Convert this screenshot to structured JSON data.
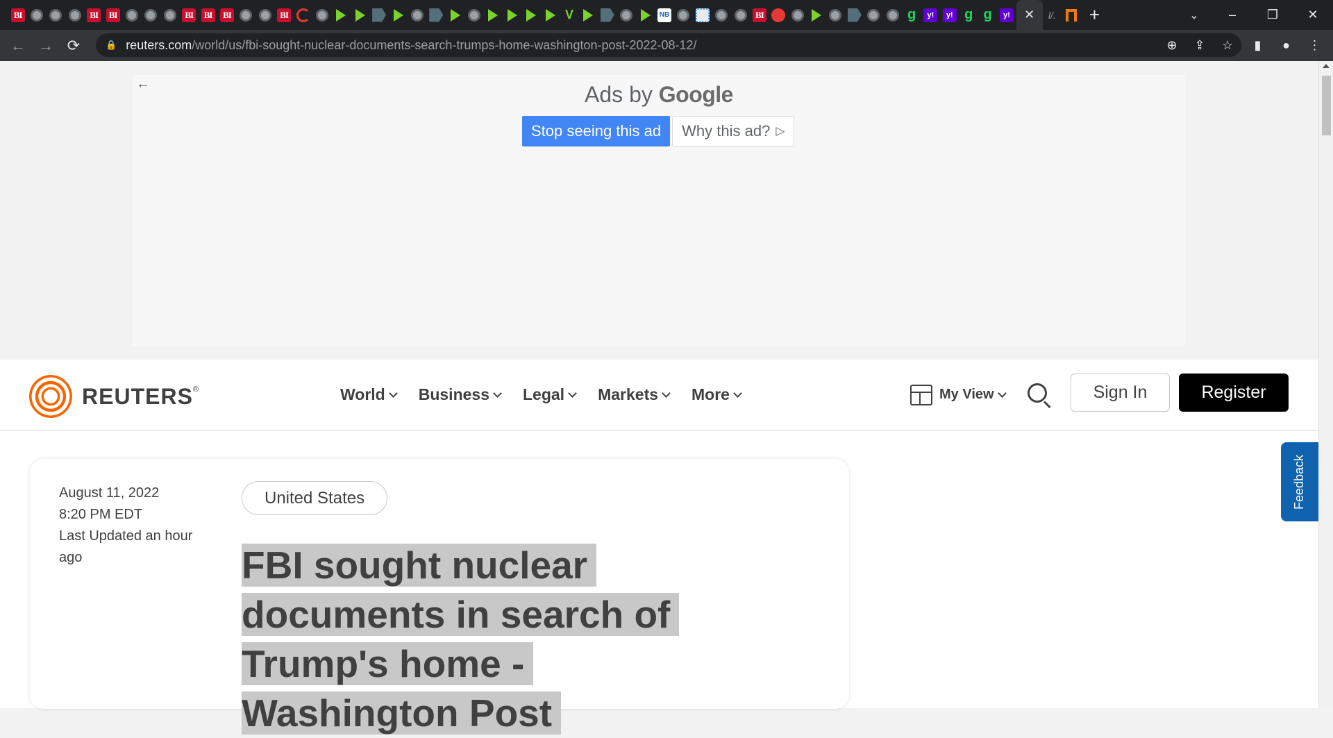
{
  "browser": {
    "tabs": [
      "bi",
      "globe",
      "globe",
      "globe",
      "bi",
      "bi",
      "globe",
      "globe",
      "globe",
      "bi",
      "bi",
      "bi",
      "globe",
      "globe",
      "bi",
      "redc",
      "globe",
      "play",
      "play",
      "flag",
      "play",
      "globe",
      "flag",
      "play",
      "globe",
      "play",
      "play",
      "play",
      "play",
      "vee",
      "play",
      "flag",
      "globe",
      "play",
      "news",
      "globe",
      "chk",
      "globe",
      "globe",
      "bi",
      "red",
      "globe",
      "play",
      "globe",
      "flag",
      "globe",
      "globe",
      "g",
      "yf",
      "yf",
      "g",
      "g",
      "yf"
    ],
    "tab_glyphs": {
      "bi": "BI",
      "yf": "y!",
      "g": "g",
      "vee": "V",
      "news": "NB",
      "slash": "l/."
    },
    "active_tab_close": "✕",
    "new_tab": "+",
    "tab_search": "⌄",
    "window_controls": {
      "minimize": "–",
      "restore": "❐",
      "close": "✕"
    },
    "nav": {
      "back": "←",
      "forward": "→",
      "reload": "⟳"
    },
    "url_host": "reuters.com",
    "url_path": "/world/us/fbi-sought-nuclear-documents-search-trumps-home-washington-post-2022-08-12/",
    "omnibox_icons": {
      "zoom": "⊕",
      "share": "⇪",
      "star": "☆"
    },
    "toolbar_icons": {
      "sidepanel": "▮",
      "profile": "●",
      "menu": "⋮"
    }
  },
  "ad": {
    "back": "←",
    "ads_by": "Ads by",
    "google": "Google",
    "stop_label": "Stop seeing this ad",
    "why_label": "Why this ad?",
    "why_icon": "▷"
  },
  "header": {
    "logo": "REUTERS",
    "logo_reg": "®",
    "nav": [
      "World",
      "Business",
      "Legal",
      "Markets",
      "More"
    ],
    "my_view": "My View",
    "sign_in": "Sign In",
    "register": "Register"
  },
  "article": {
    "date": "August 11, 2022",
    "time": "8:20 PM EDT",
    "updated": "Last Updated an hour ago",
    "tag": "United States",
    "headline_lines": [
      "FBI sought nuclear",
      "documents in search of",
      "Trump's home -",
      "Washington Post"
    ]
  },
  "feedback": "Feedback",
  "colors": {
    "brand": "#fa6400",
    "chrome_dark": "#202124",
    "ad_blue": "#4285f4",
    "feedback_blue": "#0f62ad"
  }
}
